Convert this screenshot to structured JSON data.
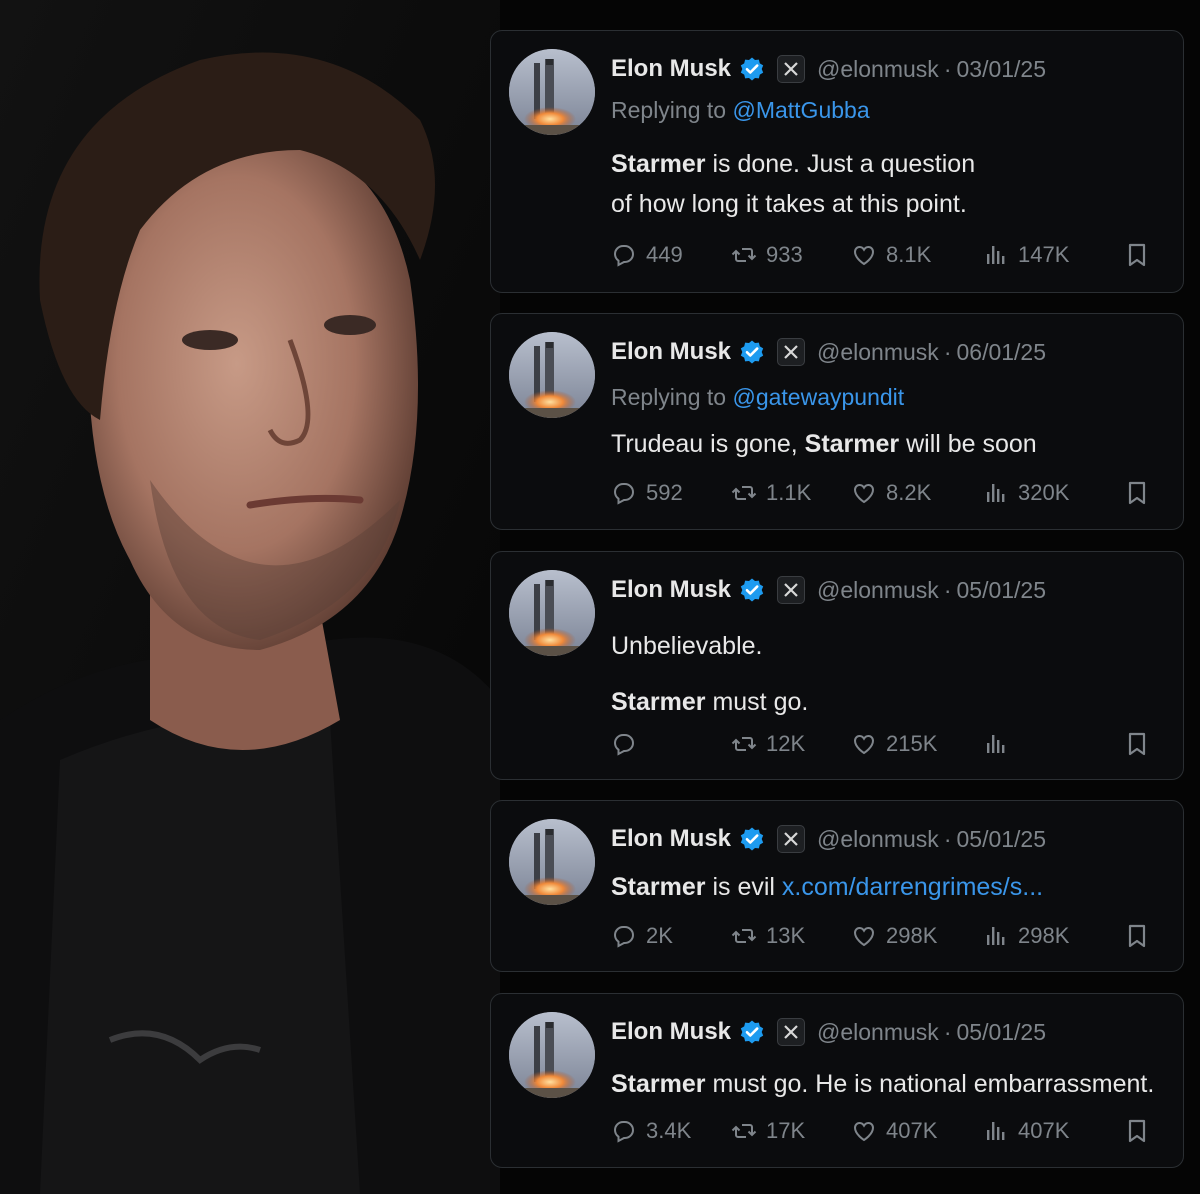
{
  "tweets": [
    {
      "name": "Elon Musk",
      "handle": "@elonmusk",
      "date": "03/01/25",
      "reply_prefix": "Replying to ",
      "reply_to": "@MattGubba",
      "lines": [
        [
          {
            "b": "Starmer"
          },
          {
            "t": " is done. Just a question"
          }
        ],
        [
          {
            "t": "of how long it takes at this point."
          }
        ]
      ],
      "replies": "449",
      "reposts": "933",
      "likes": "8.1K",
      "views": "147K"
    },
    {
      "name": "Elon Musk",
      "handle": "@elonmusk",
      "date": "06/01/25",
      "reply_prefix": "Replying to ",
      "reply_to": "@gatewaypundit",
      "lines": [
        [
          {
            "t": "Trudeau is gone, "
          },
          {
            "b": "Starmer"
          },
          {
            "t": " will be soon"
          }
        ]
      ],
      "replies": "592",
      "reposts": "1.1K",
      "likes": "8.2K",
      "views": "320K"
    },
    {
      "name": "Elon Musk",
      "handle": "@elonmusk",
      "date": "05/01/25",
      "lines": [
        [
          {
            "t": "Unbelievable."
          }
        ],
        [
          {
            "b": "Starmer"
          },
          {
            "t": " must go."
          }
        ]
      ],
      "replies": "",
      "reposts": "12K",
      "likes": "215K",
      "views": ""
    },
    {
      "name": "Elon Musk",
      "handle": "@elonmusk",
      "date": "05/01/25",
      "lines": [
        [
          {
            "b": "Starmer"
          },
          {
            "t": " is evil "
          },
          {
            "l": "x.com/darrengrimes/s..."
          }
        ]
      ],
      "replies": "2K",
      "reposts": "13K",
      "likes": "298K",
      "views": "298K"
    },
    {
      "name": "Elon Musk",
      "handle": "@elonmusk",
      "date": "05/01/25",
      "lines": [
        [
          {
            "b": "Starmer"
          },
          {
            "t": " must go. He is national embarrassment."
          }
        ]
      ],
      "replies": "3.4K",
      "reposts": "17K",
      "likes": "407K",
      "views": "407K"
    }
  ],
  "colors": {
    "background": "#050505",
    "card": "#0b0c0e",
    "border": "#2b2f33",
    "text": "#e8e8e8",
    "muted": "#7f858b",
    "link": "#3a96ea",
    "verified": "#1d9bf0"
  },
  "icons": [
    "verified-badge-icon",
    "x-logo-icon",
    "reply-icon",
    "repost-icon",
    "like-icon",
    "views-icon",
    "bookmark-icon"
  ]
}
